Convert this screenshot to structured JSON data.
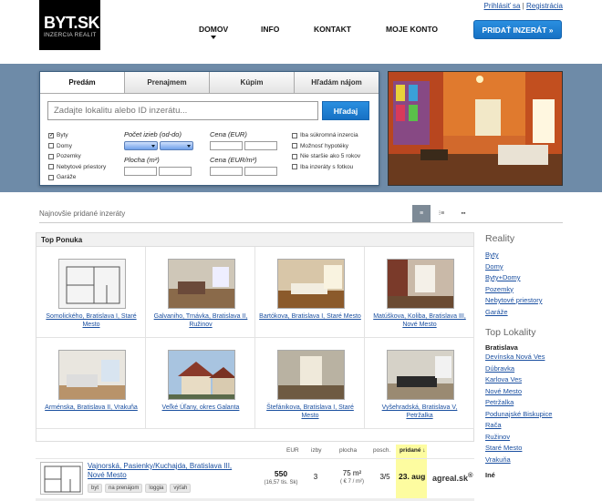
{
  "header": {
    "logo_main": "BYT.SK",
    "logo_sub": "INZERCIA REALIT",
    "login": "Prihlásiť sa",
    "separator": "|",
    "register": "Registrácia",
    "nav": [
      "DOMOV",
      "INFO",
      "KONTAKT",
      "MOJE KONTO"
    ],
    "add_button": "PRIDAŤ INZERÁT »"
  },
  "search": {
    "tabs": [
      "Predám",
      "Prenajmem",
      "Kúpim",
      "Hľadám nájom"
    ],
    "active_tab": "Predám",
    "placeholder": "Zadajte lokalitu alebo ID inzerátu...",
    "button": "Hľadaj",
    "types": [
      {
        "label": "Byty",
        "checked": true
      },
      {
        "label": "Domy",
        "checked": false
      },
      {
        "label": "Pozemky",
        "checked": false
      },
      {
        "label": "Nebytové priestory",
        "checked": false
      },
      {
        "label": "Garáže",
        "checked": false
      }
    ],
    "rooms_label": "Počet izieb (od-do)",
    "area_label": "Plocha (m²)",
    "price_label": "Cena (EUR)",
    "price_m2_label": "Cena (EUR/m²)",
    "options": [
      "Iba súkromná inzercia",
      "Možnosť hypotéky",
      "Nie staršie ako 5 rokov",
      "Iba inzeráty s fotkou"
    ]
  },
  "listing": {
    "newest_label": "Najnovšie pridané inzeráty",
    "view_icons": [
      "list-icon",
      "compact-list-icon",
      "grid-icon"
    ]
  },
  "top_offers": {
    "title": "Top Ponuka",
    "items": [
      "Somolického, Bratislava I, Staré Mesto",
      "Galvaniho, Trnávka, Bratislava II, Ružinov",
      "Bartókova, Bratislava I, Staré Mesto",
      "Matúškova, Koliba, Bratislava III, Nové Mesto",
      "Arménska, Bratislava II, Vrakuňa",
      "Veľké Úľany, okres Galanta",
      "Štefánikova, Bratislava I, Staré Mesto",
      "Vyšehradská, Bratislava V, Petržalka"
    ]
  },
  "list": {
    "columns": {
      "price": "EUR",
      "rooms": "izby",
      "area": "plocha",
      "floor": "posch.",
      "added": "pridané ↓"
    },
    "rows": [
      {
        "title": "Vajnorská, Pasienky/Kuchajda, Bratislava III, Nové Mesto",
        "tags": [
          "byt",
          "na prenájom",
          "loggia",
          "výťah"
        ],
        "price": "550",
        "price_sub": "(16,57 tis. Sk)",
        "rooms": "3",
        "area": "75 m²",
        "area_sub": "( € 7 / m²)",
        "floor": "3/5",
        "date": "23. aug",
        "agency": "agreal.sk",
        "agency_mark": "®"
      }
    ]
  },
  "sidebar": {
    "reality_title": "Reality",
    "reality_links": [
      "Byty",
      "Domy",
      "Byty+Domy",
      "Pozemky",
      "Nebytové priestory",
      "Garáže"
    ],
    "locality_title": "Top Lokality",
    "region": "Bratislava",
    "locality_links": [
      "Devínska Nová Ves",
      "Dúbravka",
      "Karlova Ves",
      "Nové Mesto",
      "Petržalka",
      "Podunajské Biskupice",
      "Rača",
      "Ružinov",
      "Staré Mesto",
      "Vrakuňa"
    ],
    "other": "Iné"
  }
}
